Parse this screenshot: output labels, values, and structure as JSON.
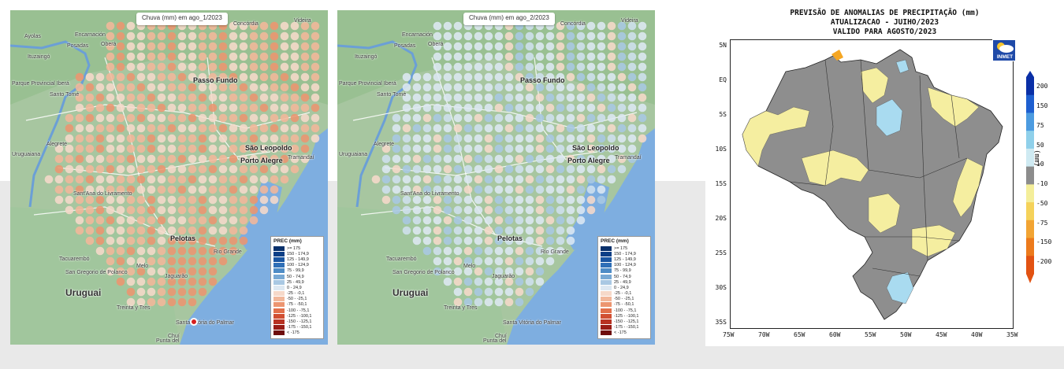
{
  "panels": [
    {
      "title": "Chuva (mm) em ago_1/2023",
      "places": {
        "ayolas": "Ayolas",
        "encarnacion": "Encarnación",
        "obera": "Oberá",
        "posadas": "Posadas",
        "ituzaingo": "Ituzaingó",
        "concordia": "Concórdia",
        "videira": "Videira",
        "passo_fundo": "Passo Fundo",
        "parque": "Parque Provincial Iberá",
        "santo_tome": "Santo Tomé",
        "alegrete": "Alegrete",
        "uruguaiana": "Uruguaiana",
        "sao_leopoldo": "São Leopoldo",
        "porto_alegre": "Porto Alegre",
        "tramandai": "Tramandaí",
        "santana": "Sant'Ana do Livramento",
        "pelotas": "Pelotas",
        "rio_grande": "Rio Grande",
        "tacuarembo": "Tacuarembó",
        "melo": "Melo",
        "jaguarao": "Jaguarão",
        "san_gregorio": "San Gregorio de Polanco",
        "uruguai": "Uruguai",
        "treinta": "Treinta y Tres",
        "santa_vitoria": "Santa Vitória do Palmar",
        "chui": "Chuí",
        "punta_del": "Punta del"
      }
    },
    {
      "title": "Chuva (mm) em ago_2/2023",
      "places": {
        "ayolas": "",
        "encarnacion": "Encarnación",
        "obera": "Oberá",
        "posadas": "Posadas",
        "ituzaingo": "Ituzaingó",
        "concordia": "Concórdia",
        "videira": "Videira",
        "passo_fundo": "Passo Fundo",
        "parque": "Parque Provincial Iberá",
        "santo_tome": "Santo Tomé",
        "alegrete": "Alegrete",
        "uruguaiana": "Uruguaiana",
        "sao_leopoldo": "São Leopoldo",
        "porto_alegre": "Porto Alegre",
        "tramandai": "Tramandaí",
        "santana": "Sant'Ana do Livramento",
        "pelotas": "Pelotas",
        "rio_grande": "Rio Grande",
        "tacuarembo": "Tacuarembó",
        "melo": "Melo",
        "jaguarao": "Jaguarão",
        "san_gregorio": "San Gregorio de Polanco",
        "uruguai": "Uruguai",
        "treinta": "Treinta y Tres",
        "santa_vitoria": "Santa Vitória do Palmar",
        "chui": "Chuí",
        "punta_del": "Punta del"
      }
    }
  ],
  "legend": {
    "title": "PREC (mm)",
    "items": [
      {
        "label": ">= 175",
        "color": "#08306b"
      },
      {
        "label": "150 - 174,9",
        "color": "#0d3f86"
      },
      {
        "label": "125 - 149,9",
        "color": "#1a56a2"
      },
      {
        "label": "100 - 124,9",
        "color": "#2f6fb7"
      },
      {
        "label": "75 - 99,9",
        "color": "#4f8cc6"
      },
      {
        "label": "50 - 74,9",
        "color": "#79a9d4"
      },
      {
        "label": "25 - 49,9",
        "color": "#a9c8e3"
      },
      {
        "label": "0 - 24,9",
        "color": "#dde8f2"
      },
      {
        "label": "-25 - -0,1",
        "color": "#f6d9c9"
      },
      {
        "label": "-50 - -25,1",
        "color": "#f2b79a"
      },
      {
        "label": "-75 - -50,1",
        "color": "#ec9570"
      },
      {
        "label": "-100 - -75,1",
        "color": "#e2704b"
      },
      {
        "label": "-125 - -100,1",
        "color": "#d14f32"
      },
      {
        "label": "-150 - -125,1",
        "color": "#b83222"
      },
      {
        "label": "-175 - -150,1",
        "color": "#991d16"
      },
      {
        "label": "< -175",
        "color": "#6e0d0d"
      }
    ]
  },
  "inmet": {
    "title_lines": [
      "PREVISÃO DE ANOMALIAS DE PRECIPITAÇÃO (mm)",
      "ATUALIZACAO - JUIHO/2023",
      "VALIDO PARA AGOSTO/2023"
    ],
    "logo_text": "INMET",
    "lat_ticks": [
      "5N",
      "EQ",
      "5S",
      "10S",
      "15S",
      "20S",
      "25S",
      "30S",
      "35S"
    ],
    "lon_ticks": [
      "75W",
      "70W",
      "65W",
      "60W",
      "55W",
      "50W",
      "45W",
      "40W",
      "35W"
    ],
    "colorbar_ticks": [
      "200",
      "150",
      "75",
      "50",
      "10",
      "-10",
      "-50",
      "-75",
      "-150",
      "-200"
    ],
    "colorbar_colors": [
      "#0a2fa6",
      "#1e5fd0",
      "#4c9be0",
      "#8fd0ea",
      "#cfeaf2",
      "#8c8c8c",
      "#f4ee9a",
      "#f5d25a",
      "#f2a433",
      "#ec7a1c",
      "#e25212"
    ],
    "unit": "(mm)",
    "colors": {
      "gray": "#8e8e8e",
      "yellow": "#f5eea0",
      "lightblue": "#a9dbf0",
      "orange": "#f5a623"
    }
  }
}
